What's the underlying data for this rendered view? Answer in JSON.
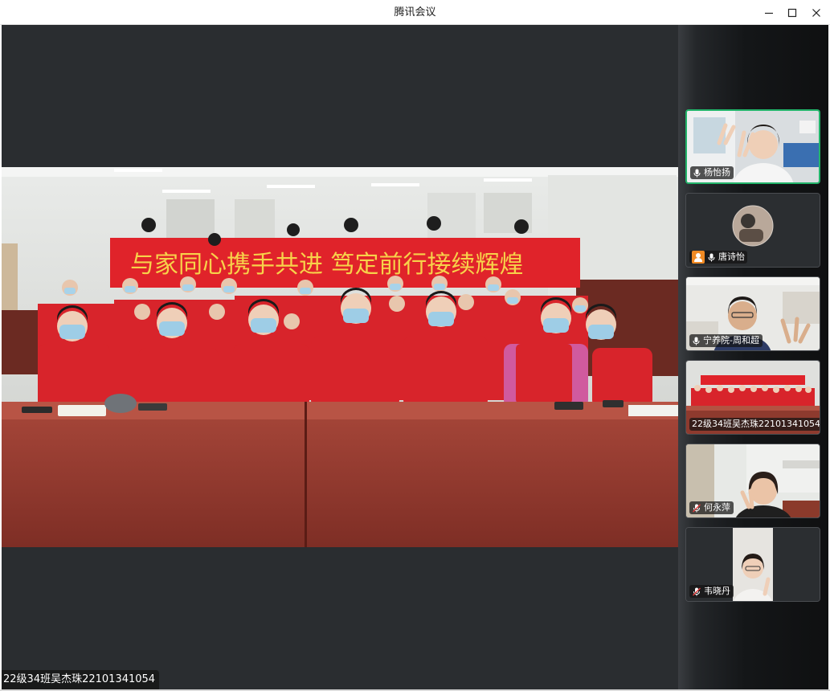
{
  "window": {
    "title": "腾讯会议"
  },
  "main": {
    "caption": "22级34班吴杰珠22101341054",
    "banner_text": "与家同心携手共进  笃定前行接续辉煌"
  },
  "participants": [
    {
      "name": "杨怡扬",
      "mic": "on",
      "active": true
    },
    {
      "name": "唐诗怡",
      "mic": "on",
      "host": true
    },
    {
      "name": "宁养院-周和超",
      "mic": "on"
    },
    {
      "name": "22级34班吴杰珠22101341054",
      "mic": "none"
    },
    {
      "name": "何永萍",
      "mic": "muted"
    },
    {
      "name": "韦晓丹",
      "mic": "muted"
    }
  ],
  "colors": {
    "accent_green": "#22b46a",
    "muted_red": "#e23b3b",
    "host_orange": "#f08a24",
    "vest_red": "#d8242b"
  }
}
